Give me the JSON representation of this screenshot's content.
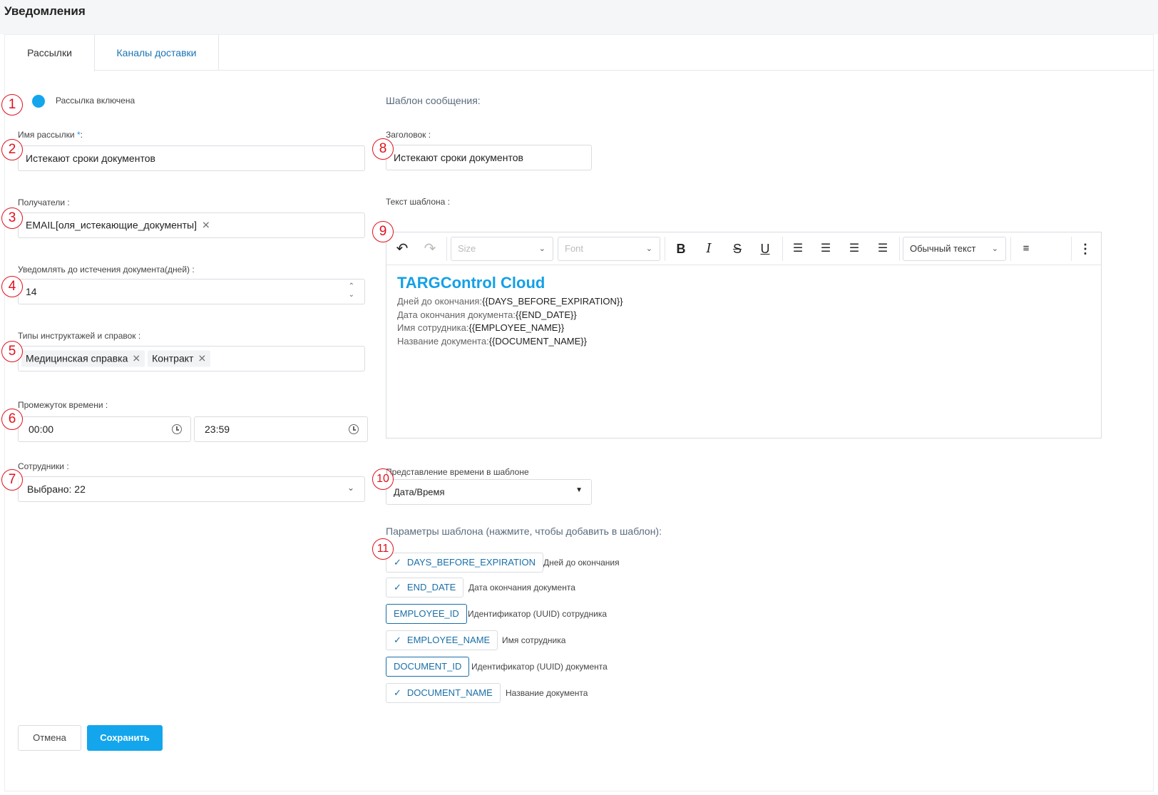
{
  "page": {
    "title": "Уведомления"
  },
  "tabs": [
    {
      "label": "Рассылки",
      "active": true
    },
    {
      "label": "Каналы доставки",
      "active": false
    }
  ],
  "form": {
    "enabled_label": "Рассылка включена",
    "enabled": true,
    "name": {
      "label": "Имя рассылки",
      "required_mark": "*",
      "label_suffix": ":",
      "value": "Истекают сроки документов"
    },
    "recipients": {
      "label": "Получатели :",
      "chips": [
        "EMAIL[оля_истекающие_документы]"
      ]
    },
    "days_before": {
      "label": "Уведомлять до истечения документа(дней) :",
      "value": "14"
    },
    "types": {
      "label": "Типы инструктажей и справок :",
      "chips": [
        "Медицинская справка",
        "Контракт"
      ]
    },
    "time_range": {
      "label": "Промежуток времени :",
      "from": "00:00",
      "to": "23:59"
    },
    "employees": {
      "label": "Сотрудники :",
      "value": "Выбрано: 22"
    }
  },
  "template": {
    "section_title": "Шаблон сообщения:",
    "header": {
      "label": "Заголовок :",
      "value": "Истекают сроки документов"
    },
    "text_label": "Текст шаблона :",
    "toolbar": {
      "size_placeholder": "Size",
      "font_placeholder": "Font",
      "style_value": "Обычный текст"
    },
    "body": {
      "title": "TARGControl Cloud",
      "lines": [
        {
          "label": "Дней до окончания:",
          "var": "{{DAYS_BEFORE_EXPIRATION}}"
        },
        {
          "label": "Дата окончания документа:",
          "var": "{{END_DATE}}"
        },
        {
          "label": "Имя сотрудника:",
          "var": "{{EMPLOYEE_NAME}}"
        },
        {
          "label": "Название документа:",
          "var": "{{DOCUMENT_NAME}}"
        }
      ]
    },
    "time_format": {
      "label": "Представление времени в шаблоне",
      "value": "Дата/Время"
    },
    "params_title": "Параметры шаблона (нажмите, чтобы добавить в шаблон):",
    "params": [
      {
        "name": "DAYS_BEFORE_EXPIRATION",
        "desc": "Дней до окончания",
        "checked": true
      },
      {
        "name": "END_DATE",
        "desc": "Дата окончания документа",
        "checked": true
      },
      {
        "name": "EMPLOYEE_ID",
        "desc": "Идентификатор (UUID) сотрудника",
        "checked": false
      },
      {
        "name": "EMPLOYEE_NAME",
        "desc": "Имя сотрудника",
        "checked": true
      },
      {
        "name": "DOCUMENT_ID",
        "desc": "Идентификатор (UUID) документа",
        "checked": false
      },
      {
        "name": "DOCUMENT_NAME",
        "desc": "Название документа",
        "checked": true
      }
    ]
  },
  "actions": {
    "cancel": "Отмена",
    "save": "Сохранить"
  },
  "markers": [
    "1",
    "2",
    "3",
    "4",
    "5",
    "6",
    "7",
    "8",
    "9",
    "10",
    "11"
  ],
  "colors": {
    "accent": "#13a6ec",
    "link": "#1a6fa8",
    "marker": "#e0101c"
  }
}
